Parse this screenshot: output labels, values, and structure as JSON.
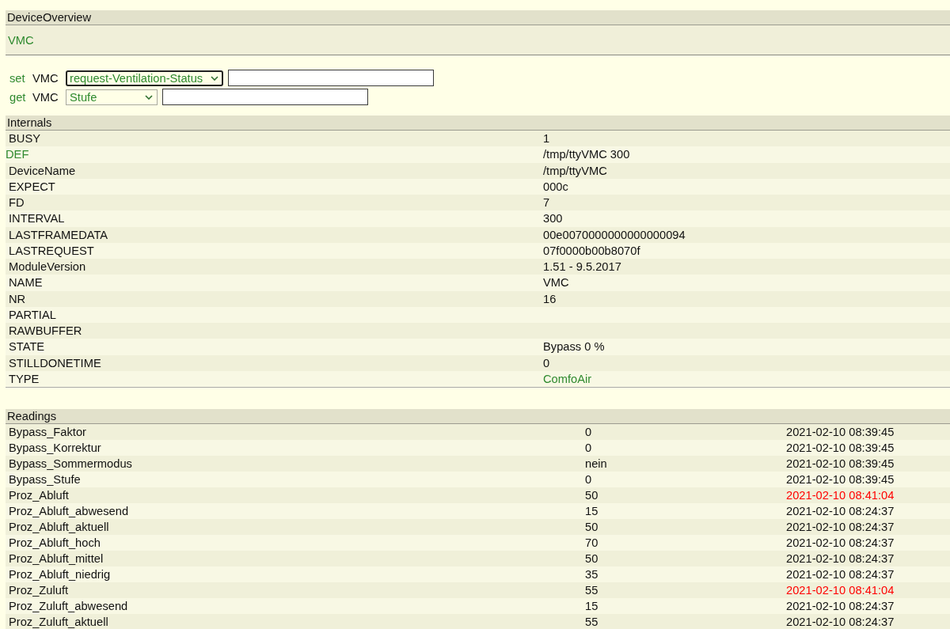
{
  "device_overview": {
    "title": "DeviceOverview",
    "device_link": "VMC"
  },
  "commands": [
    {
      "command": "set",
      "device": "VMC",
      "selected_option": "request-Ventilation-Status",
      "focused": true
    },
    {
      "command": "get",
      "device": "VMC",
      "selected_option": "Stufe",
      "focused": false
    }
  ],
  "internals": {
    "title": "Internals",
    "rows": [
      {
        "name": "BUSY",
        "value": "1",
        "name_link": false,
        "value_link": false
      },
      {
        "name": "DEF",
        "value": "/tmp/ttyVMC 300",
        "name_link": true,
        "value_link": false
      },
      {
        "name": "DeviceName",
        "value": "/tmp/ttyVMC",
        "name_link": false,
        "value_link": false
      },
      {
        "name": "EXPECT",
        "value": "000c",
        "name_link": false,
        "value_link": false
      },
      {
        "name": "FD",
        "value": "7",
        "name_link": false,
        "value_link": false
      },
      {
        "name": "INTERVAL",
        "value": "300",
        "name_link": false,
        "value_link": false
      },
      {
        "name": "LASTFRAMEDATA",
        "value": "00e0070000000000000094",
        "name_link": false,
        "value_link": false
      },
      {
        "name": "LASTREQUEST",
        "value": "07f0000b00b8070f",
        "name_link": false,
        "value_link": false
      },
      {
        "name": "ModuleVersion",
        "value": "1.51 - 9.5.2017",
        "name_link": false,
        "value_link": false
      },
      {
        "name": "NAME",
        "value": "VMC",
        "name_link": false,
        "value_link": false
      },
      {
        "name": "NR",
        "value": "16",
        "name_link": false,
        "value_link": false
      },
      {
        "name": "PARTIAL",
        "name_link": false
      },
      {
        "name": "RAWBUFFER",
        "name_link": false
      },
      {
        "name": "STATE",
        "value": "Bypass 0 %",
        "name_link": false,
        "value_link": false
      },
      {
        "name": "STILLDONETIME",
        "value": "0",
        "name_link": false,
        "value_link": false
      },
      {
        "name": "TYPE",
        "value": "ComfoAir",
        "name_link": false,
        "value_link": true
      }
    ]
  },
  "readings": {
    "title": "Readings",
    "rows": [
      {
        "name": "Bypass_Faktor",
        "value": "0",
        "time": "2021-02-10 08:39:45",
        "recent": false
      },
      {
        "name": "Bypass_Korrektur",
        "value": "0",
        "time": "2021-02-10 08:39:45",
        "recent": false
      },
      {
        "name": "Bypass_Sommermodus",
        "value": "nein",
        "time": "2021-02-10 08:39:45",
        "recent": false
      },
      {
        "name": "Bypass_Stufe",
        "value": "0",
        "time": "2021-02-10 08:39:45",
        "recent": false
      },
      {
        "name": "Proz_Abluft",
        "value": "50",
        "time": "2021-02-10 08:41:04",
        "recent": true
      },
      {
        "name": "Proz_Abluft_abwesend",
        "value": "15",
        "time": "2021-02-10 08:24:37",
        "recent": false
      },
      {
        "name": "Proz_Abluft_aktuell",
        "value": "50",
        "time": "2021-02-10 08:24:37",
        "recent": false
      },
      {
        "name": "Proz_Abluft_hoch",
        "value": "70",
        "time": "2021-02-10 08:24:37",
        "recent": false
      },
      {
        "name": "Proz_Abluft_mittel",
        "value": "50",
        "time": "2021-02-10 08:24:37",
        "recent": false
      },
      {
        "name": "Proz_Abluft_niedrig",
        "value": "35",
        "time": "2021-02-10 08:24:37",
        "recent": false
      },
      {
        "name": "Proz_Zuluft",
        "value": "55",
        "time": "2021-02-10 08:41:04",
        "recent": true
      },
      {
        "name": "Proz_Zuluft_abwesend",
        "value": "15",
        "time": "2021-02-10 08:24:37",
        "recent": false
      },
      {
        "name": "Proz_Zuluft_aktuell",
        "value": "55",
        "time": "2021-02-10 08:24:37",
        "recent": false
      }
    ]
  }
}
